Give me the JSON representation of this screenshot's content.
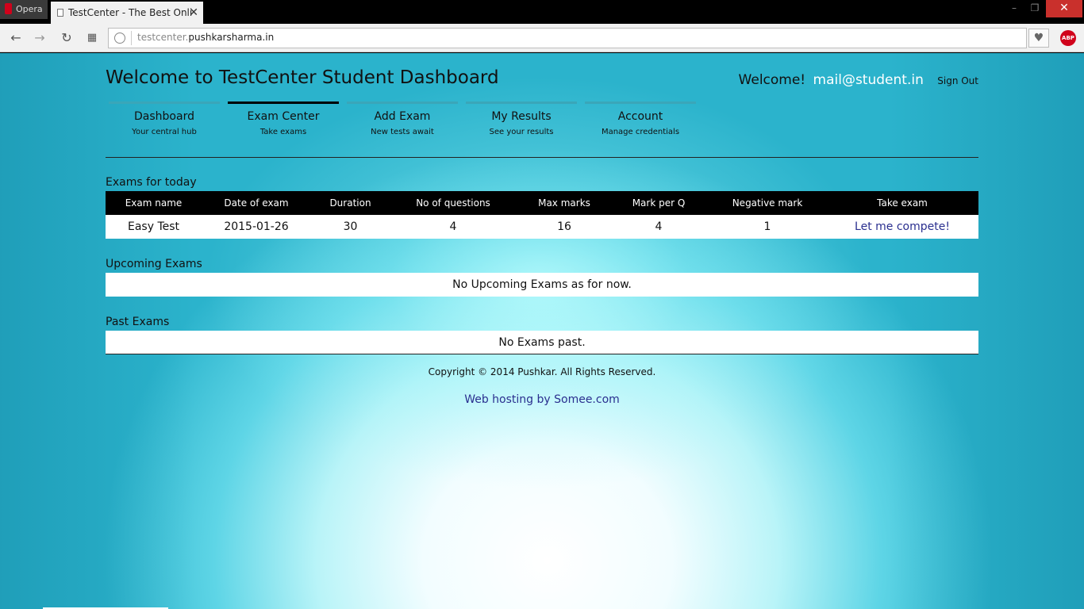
{
  "browser": {
    "app_name": "Opera",
    "tab_title": "TestCenter - The Best Onli",
    "tab_close": "✕",
    "url_prefix": "testcenter.",
    "url_domain": "pushkarsharma.in",
    "window_min": "–",
    "window_max": "❐",
    "window_close": "✕",
    "nav_icons": [
      "arrow-left-icon",
      "arrow-right-icon",
      "reload-icon",
      "speed-dial-icon"
    ],
    "adblock_label": "ABP"
  },
  "header": {
    "site_title": "Welcome to TestCenter Student Dashboard",
    "welcome_prefix": "Welcome!",
    "user_email": "mail@student.in",
    "sign_out": "Sign Out"
  },
  "menu": [
    {
      "title": "Dashboard",
      "subtitle": "Your central hub",
      "active": false
    },
    {
      "title": "Exam Center",
      "subtitle": "Take exams",
      "active": true
    },
    {
      "title": "Add Exam",
      "subtitle": "New tests await",
      "active": false
    },
    {
      "title": "My Results",
      "subtitle": "See your results",
      "active": false
    },
    {
      "title": "Account",
      "subtitle": "Manage credentials",
      "active": false
    }
  ],
  "exams_today": {
    "label": "Exams for today",
    "columns": [
      "Exam name",
      "Date of exam",
      "Duration",
      "No of questions",
      "Max marks",
      "Mark per Q",
      "Negative mark",
      "Take exam"
    ],
    "rows": [
      [
        "Easy Test",
        "2015-01-26",
        "30",
        "4",
        "16",
        "4",
        "1",
        "Let me compete!"
      ]
    ]
  },
  "upcoming": {
    "label": "Upcoming Exams",
    "empty_text": "No Upcoming Exams as for now."
  },
  "past": {
    "label": "Past Exams",
    "empty_text": "No Exams past."
  },
  "footer": {
    "copyright": "Copyright © 2014 Pushkar. All Rights Reserved.",
    "hosting": "Web hosting by Somee.com"
  },
  "colors": {
    "page_background": "#2bb3cc",
    "menu_bar": "#3aa6b9",
    "menu_bar_active": "#000000",
    "table_header": "#000000",
    "link": "#2a2f8f"
  }
}
